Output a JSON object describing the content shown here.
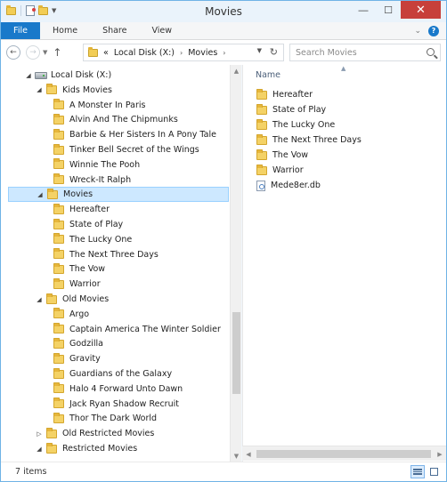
{
  "window": {
    "title": "Movies"
  },
  "ribbon": {
    "tabs": [
      {
        "label": "File",
        "active": true
      },
      {
        "label": "Home"
      },
      {
        "label": "Share"
      },
      {
        "label": "View"
      }
    ],
    "expand_glyph": "⌄",
    "help_glyph": "?"
  },
  "address": {
    "overflow": "«",
    "crumbs": [
      "Local Disk (X:)",
      "Movies"
    ],
    "separator": "›"
  },
  "search": {
    "placeholder": "Search Movies"
  },
  "nav_tree": [
    {
      "label": "Local Disk (X:)",
      "level": 0,
      "icon": "drive-icon",
      "expanded": true
    },
    {
      "label": "Kids Movies",
      "level": 1,
      "icon": "folder-icon",
      "expanded": true
    },
    {
      "label": "A Monster In Paris",
      "level": 2,
      "icon": "folder-icon"
    },
    {
      "label": "Alvin And The Chipmunks",
      "level": 2,
      "icon": "folder-icon"
    },
    {
      "label": "Barbie & Her Sisters In A Pony Tale",
      "level": 2,
      "icon": "folder-icon"
    },
    {
      "label": "Tinker Bell Secret of the Wings",
      "level": 2,
      "icon": "folder-icon"
    },
    {
      "label": "Winnie The Pooh",
      "level": 2,
      "icon": "folder-icon"
    },
    {
      "label": "Wreck-It Ralph",
      "level": 2,
      "icon": "folder-icon"
    },
    {
      "label": "Movies",
      "level": 1,
      "icon": "folder-icon",
      "expanded": true,
      "selected": true
    },
    {
      "label": "Hereafter",
      "level": 2,
      "icon": "folder-icon"
    },
    {
      "label": "State of Play",
      "level": 2,
      "icon": "folder-icon"
    },
    {
      "label": "The Lucky One",
      "level": 2,
      "icon": "folder-icon"
    },
    {
      "label": "The Next Three Days",
      "level": 2,
      "icon": "folder-icon"
    },
    {
      "label": "The Vow",
      "level": 2,
      "icon": "folder-icon"
    },
    {
      "label": "Warrior",
      "level": 2,
      "icon": "folder-icon"
    },
    {
      "label": "Old Movies",
      "level": 1,
      "icon": "folder-icon",
      "expanded": true
    },
    {
      "label": "Argo",
      "level": 2,
      "icon": "folder-icon"
    },
    {
      "label": "Captain America The Winter Soldier",
      "level": 2,
      "icon": "folder-icon"
    },
    {
      "label": "Godzilla",
      "level": 2,
      "icon": "folder-icon"
    },
    {
      "label": "Gravity",
      "level": 2,
      "icon": "folder-icon"
    },
    {
      "label": "Guardians of the Galaxy",
      "level": 2,
      "icon": "folder-icon"
    },
    {
      "label": "Halo 4 Forward Unto Dawn",
      "level": 2,
      "icon": "folder-icon"
    },
    {
      "label": "Jack Ryan Shadow Recruit",
      "level": 2,
      "icon": "folder-icon"
    },
    {
      "label": "Thor The Dark World",
      "level": 2,
      "icon": "folder-icon"
    },
    {
      "label": "Old Restricted Movies",
      "level": 1,
      "icon": "folder-icon",
      "expanded": false
    },
    {
      "label": "Restricted Movies",
      "level": 1,
      "icon": "folder-icon",
      "expanded": true
    }
  ],
  "content": {
    "column_header": "Name",
    "items": [
      {
        "name": "Hereafter",
        "icon": "folder-icon"
      },
      {
        "name": "State of Play",
        "icon": "folder-icon"
      },
      {
        "name": "The Lucky One",
        "icon": "folder-icon"
      },
      {
        "name": "The Next Three Days",
        "icon": "folder-icon"
      },
      {
        "name": "The Vow",
        "icon": "folder-icon"
      },
      {
        "name": "Warrior",
        "icon": "folder-icon"
      },
      {
        "name": "Mede8er.db",
        "icon": "db-file-icon"
      }
    ]
  },
  "status": {
    "item_count": "7 items"
  },
  "colors": {
    "accent": "#1979ca",
    "close": "#c7403a",
    "selection": "#cde8ff",
    "folder": "#f4d266"
  }
}
